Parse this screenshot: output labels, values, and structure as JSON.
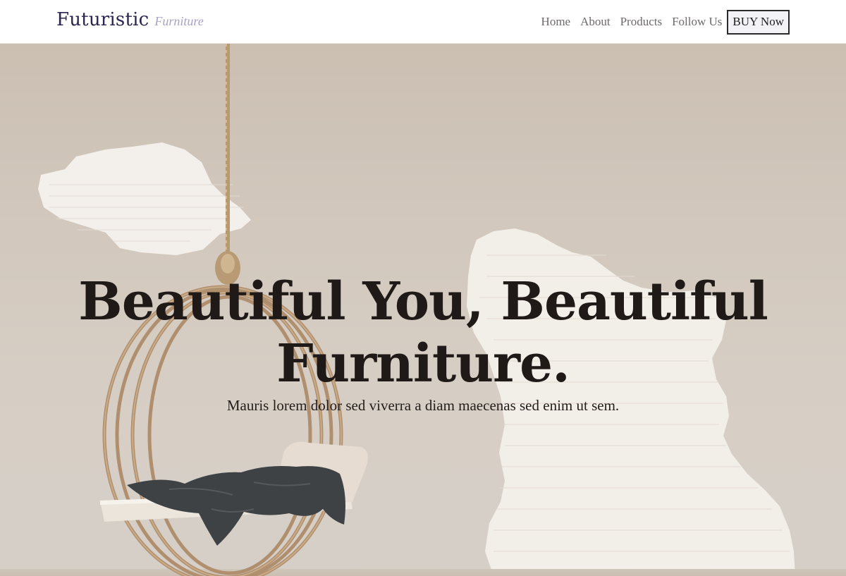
{
  "brand": {
    "name": "Futuristic",
    "tagline": "Furniture"
  },
  "nav": {
    "items": [
      "Home",
      "About",
      "Products",
      "Follow Us"
    ],
    "cta_label": "BUY Now"
  },
  "hero": {
    "title_line1": "Beautiful You, Beautiful",
    "title_line2": "Furniture.",
    "subtitle": "Mauris lorem dolor sed viverra a diam maecenas sed enim ut sem."
  },
  "colors": {
    "brand": "#2b2550",
    "brand_accent": "#a9a1c4",
    "nav_text": "#6e6a6a",
    "hero_text": "#1f1917",
    "hero_bg": "#d2c8bd"
  }
}
